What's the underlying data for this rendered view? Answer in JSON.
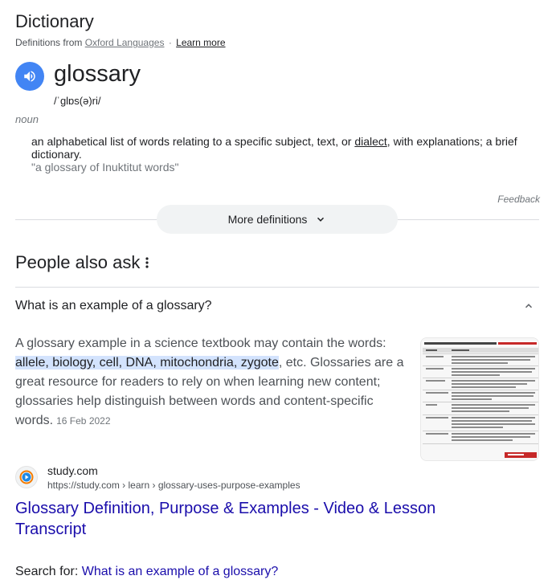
{
  "dictionary": {
    "title": "Dictionary",
    "source_prefix": "Definitions from",
    "source_name": "Oxford Languages",
    "separator": "·",
    "learn_more": "Learn more",
    "word": "glossary",
    "phonetic": "/ˈɡlɒs(ə)ri/",
    "part_of_speech": "noun",
    "definition_before": "an alphabetical list of words relating to a specific subject, text, or ",
    "definition_link": "dialect",
    "definition_after": ", with explanations; a brief dictionary.",
    "example": "\"a glossary of Inuktitut words\"",
    "feedback": "Feedback",
    "more_definitions": "More definitions"
  },
  "people_also_ask": {
    "title": "People also ask",
    "question": "What is an example of a glossary?",
    "answer_before": "A glossary example in a science textbook may contain the words: ",
    "answer_highlight": "allele, biology, cell, DNA, mitochondria, zygote",
    "answer_after": ", etc. Glossaries are a great resource for readers to rely on when learning new content; glossaries help distinguish between words and content-specific words.",
    "answer_date": "16 Feb 2022",
    "source_site": "study.com",
    "source_url": "https://study.com › learn › glossary-uses-purpose-examples",
    "result_title": "Glossary Definition, Purpose & Examples - Video & Lesson Transcript",
    "search_for_label": "Search for:",
    "search_for_query": "What is an example of a glossary?"
  },
  "colors": {
    "speaker_button": "#4285f4",
    "link": "#1a0dab",
    "highlight": "#d3e3fd",
    "chip_bg": "#f1f3f4",
    "thumb_accent": "#c62828"
  },
  "icons": {
    "speaker": "speaker-icon",
    "more_chevron": "chevron-down-icon",
    "paa_menu": "more-vert-icon",
    "collapse": "chevron-up-icon",
    "site_favicon": "play-circle-icon"
  }
}
